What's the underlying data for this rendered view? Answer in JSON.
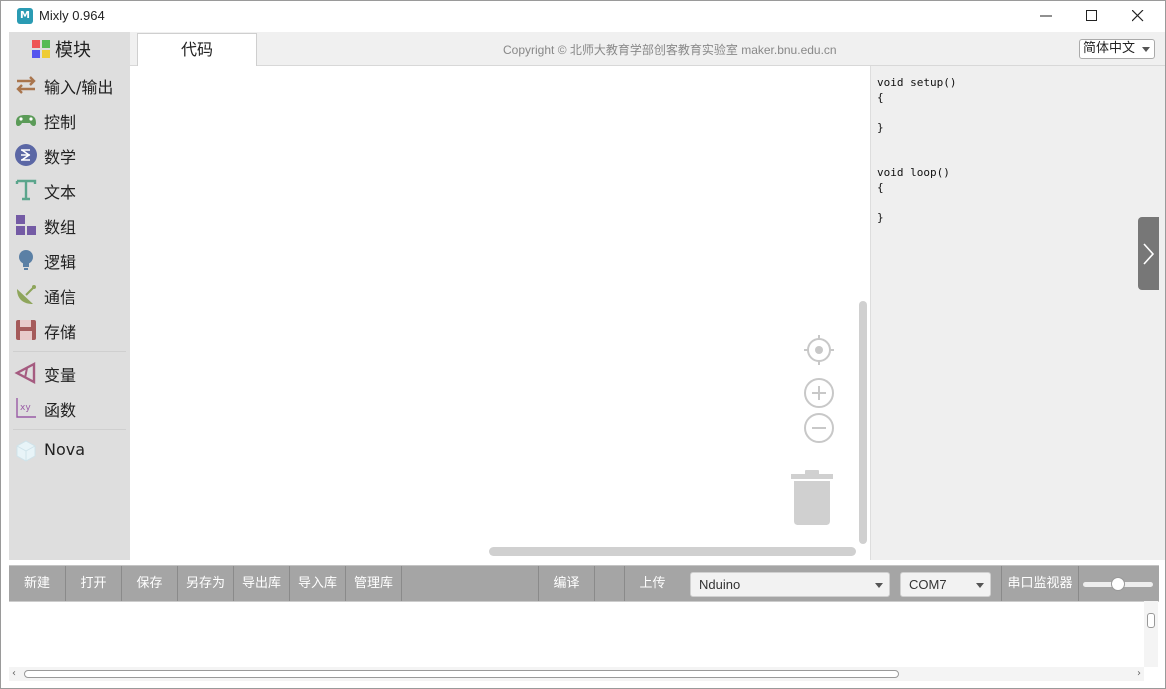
{
  "window": {
    "title": "Mixly 0.964",
    "app_icon_text": "M"
  },
  "sidebar": {
    "module_tab": "模块",
    "categories": [
      {
        "label": "输入/输出",
        "icon": "arrows-exchange-icon",
        "color": "#a9754d"
      },
      {
        "label": "控制",
        "icon": "gamepad-icon",
        "color": "#5b9b58"
      },
      {
        "label": "数学",
        "icon": "math-sigma-icon",
        "color": "#5b67a5"
      },
      {
        "label": "文本",
        "icon": "text-t-icon",
        "color": "#5ba58c"
      },
      {
        "label": "数组",
        "icon": "array-blocks-icon",
        "color": "#745ba5"
      },
      {
        "label": "逻辑",
        "icon": "lightbulb-icon",
        "color": "#5b80a5"
      },
      {
        "label": "通信",
        "icon": "satellite-dish-icon",
        "color": "#8ea55b"
      },
      {
        "label": "存储",
        "icon": "floppy-disk-icon",
        "color": "#a55b5b"
      },
      {
        "label": "变量",
        "icon": "variable-cone-icon",
        "color": "#a55b80"
      },
      {
        "label": "函数",
        "icon": "function-xy-icon",
        "color": "#995ba5"
      },
      {
        "label": "Nova",
        "icon": "cube-icon",
        "color": "#8ec8d8"
      }
    ]
  },
  "tabs": {
    "code_tab": "代码"
  },
  "header": {
    "copyright": "Copyright © 北师大教育学部创客教育实验室 maker.bnu.edu.cn",
    "language": "简体中文"
  },
  "code": "void setup()\n{\n\n}\n\n\nvoid loop()\n{\n\n}",
  "toolbar": {
    "new": "新建",
    "open": "打开",
    "save": "保存",
    "save_as": "另存为",
    "export_lib": "导出库",
    "import_lib": "导入库",
    "manage_lib": "管理库",
    "compile": "编译",
    "upload": "上传",
    "board": "Nduino",
    "port": "COM7",
    "serial_monitor": "串口监视器"
  },
  "colors": {
    "toolbar_bg": "#a5a5a5",
    "sidebar_bg": "#dedede",
    "code_bg": "#efefef"
  }
}
